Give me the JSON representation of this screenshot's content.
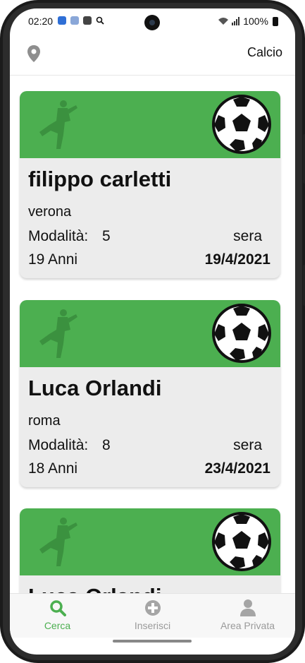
{
  "status_bar": {
    "time": "02:20",
    "battery": "100%"
  },
  "header": {
    "title": "Calcio",
    "location_icon": "location-pin-icon"
  },
  "cards": [
    {
      "name": "filippo carletti",
      "city": "verona",
      "mode_label": "Modalità:",
      "mode_value": "5",
      "time_of_day": "sera",
      "age": "19 Anni",
      "date": "19/4/2021"
    },
    {
      "name": "Luca Orlandi",
      "city": "roma",
      "mode_label": "Modalità:",
      "mode_value": "8",
      "time_of_day": "sera",
      "age": "18 Anni",
      "date": "23/4/2021"
    },
    {
      "name": "Luca Orlandi",
      "city": "",
      "mode_label": "",
      "mode_value": "",
      "time_of_day": "",
      "age": "",
      "date": ""
    }
  ],
  "bottom_nav": {
    "items": [
      {
        "label": "Cerca",
        "icon": "search-icon",
        "active": true
      },
      {
        "label": "Inserisci",
        "icon": "plus-circle-icon",
        "active": false
      },
      {
        "label": "Area Privata",
        "icon": "user-icon",
        "active": false
      }
    ]
  },
  "colors": {
    "accent": "#4caf50",
    "card_bg": "#ececec",
    "inactive": "#9a9a9a"
  }
}
